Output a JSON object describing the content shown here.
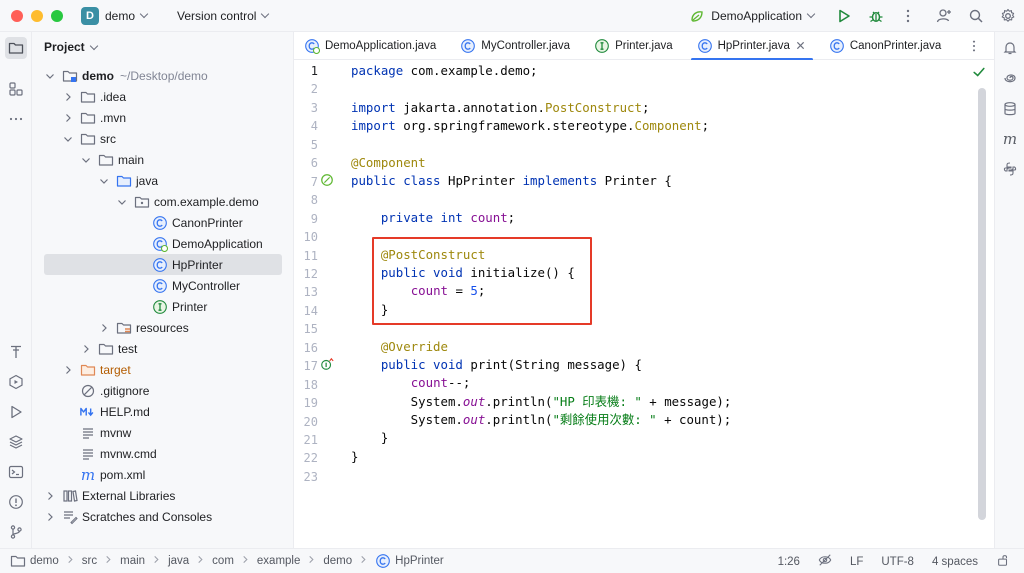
{
  "titlebar": {
    "project_badge": "D",
    "project_name": "demo",
    "vcs_label": "Version control",
    "run_config": "DemoApplication"
  },
  "project_panel": {
    "title": "Project",
    "tree": [
      {
        "label": "demo",
        "hint": "~/Desktop/demo",
        "icon": "module-folder-icon"
      },
      {
        "label": ".idea",
        "icon": "folder-icon"
      },
      {
        "label": ".mvn",
        "icon": "folder-icon"
      },
      {
        "label": "src",
        "icon": "folder-icon"
      },
      {
        "label": "main",
        "icon": "folder-icon"
      },
      {
        "label": "java",
        "icon": "source-folder-icon"
      },
      {
        "label": "com.example.demo",
        "icon": "package-icon"
      },
      {
        "label": "CanonPrinter",
        "icon": "class-icon"
      },
      {
        "label": "DemoApplication",
        "icon": "spring-class-icon"
      },
      {
        "label": "HpPrinter",
        "icon": "class-icon"
      },
      {
        "label": "MyController",
        "icon": "class-icon"
      },
      {
        "label": "Printer",
        "icon": "interface-icon"
      },
      {
        "label": "resources",
        "icon": "resources-folder-icon"
      },
      {
        "label": "test",
        "icon": "folder-icon"
      },
      {
        "label": "target",
        "icon": "excluded-folder-icon"
      },
      {
        "label": ".gitignore",
        "icon": "gitignore-icon"
      },
      {
        "label": "HELP.md",
        "icon": "markdown-icon"
      },
      {
        "label": "mvnw",
        "icon": "text-file-icon"
      },
      {
        "label": "mvnw.cmd",
        "icon": "text-file-icon"
      },
      {
        "label": "pom.xml",
        "icon": "maven-icon"
      },
      {
        "label": "External Libraries",
        "icon": "libraries-icon"
      },
      {
        "label": "Scratches and Consoles",
        "icon": "scratches-icon"
      }
    ]
  },
  "tabs": [
    {
      "label": "DemoApplication.java",
      "icon": "spring-class-icon"
    },
    {
      "label": "MyController.java",
      "icon": "class-icon"
    },
    {
      "label": "Printer.java",
      "icon": "interface-icon"
    },
    {
      "label": "HpPrinter.java",
      "icon": "class-icon",
      "active": true
    },
    {
      "label": "CanonPrinter.java",
      "icon": "class-icon"
    }
  ],
  "editor": {
    "line_numbers": [
      "1",
      "2",
      "3",
      "4",
      "5",
      "6",
      "7",
      "8",
      "9",
      "10",
      "11",
      "12",
      "13",
      "14",
      "15",
      "16",
      "17",
      "18",
      "19",
      "20",
      "21",
      "22",
      "23"
    ],
    "current_line": "1",
    "code": {
      "l1a": "package",
      "l1b": " com.example.demo;",
      "l3a": "import",
      "l3b": " jakarta.annotation.",
      "l3c": "PostConstruct",
      "l3d": ";",
      "l4a": "import",
      "l4b": " org.springframework.stereotype.",
      "l4c": "Component",
      "l4d": ";",
      "l6": "@Component",
      "l7a": "public class",
      "l7b": " HpPrinter ",
      "l7c": "implements",
      "l7d": " Printer {",
      "l9a": "    private int ",
      "l9b": "count",
      "l9c": ";",
      "l11": "    @PostConstruct",
      "l12a": "    public void ",
      "l12b": "initialize() {",
      "l13a": "        ",
      "l13b": "count",
      "l13c": " = ",
      "l13d": "5",
      "l13e": ";",
      "l14": "    }",
      "l16": "    @Override",
      "l17a": "    public void ",
      "l17b": "print(String message) {",
      "l18a": "        ",
      "l18b": "count",
      "l18c": "--;",
      "l19a": "        System.",
      "l19b": "out",
      "l19c": ".println(",
      "l19d": "\"HP 印表機: \"",
      "l19e": " + message);",
      "l20a": "        System.",
      "l20b": "out",
      "l20c": ".println(",
      "l20d": "\"剩餘使用次數: \"",
      "l20e": " + count);",
      "l21": "    }",
      "l22": "}"
    }
  },
  "statusbar": {
    "breadcrumbs": [
      "demo",
      "src",
      "main",
      "java",
      "com",
      "example",
      "demo",
      "HpPrinter"
    ],
    "position": "1:26",
    "line_separator": "LF",
    "encoding": "UTF-8",
    "indent": "4 spaces"
  },
  "colors": {
    "accent": "#3574f0",
    "highlight_box": "#e53a28",
    "keyword": "#0033b3",
    "annotation": "#9e880d",
    "field": "#871094",
    "string": "#067d17"
  }
}
